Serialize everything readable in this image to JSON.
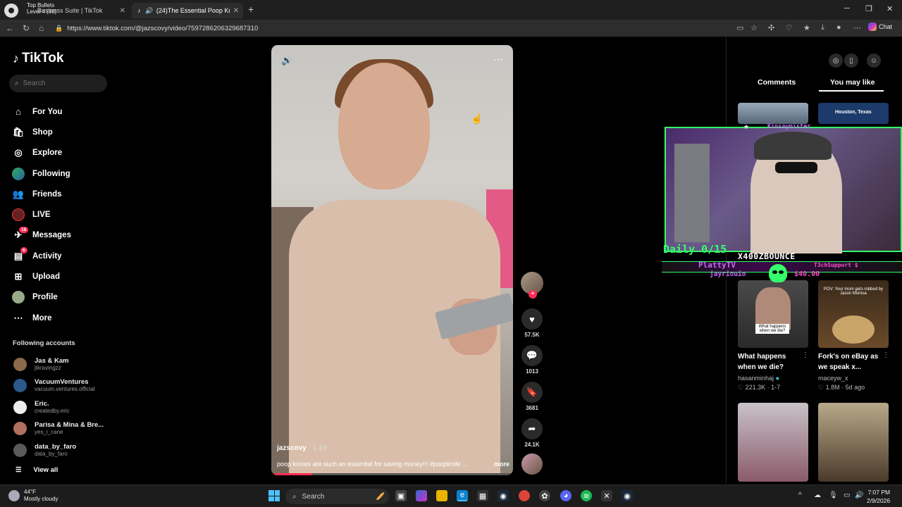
{
  "browser": {
    "obs_label_line1": "Top Bullets",
    "obs_label_line2": "Level 4  (86)",
    "tabs": [
      {
        "label": "Business Suite | TikTok"
      },
      {
        "label": "(24)The Essential Poop Knife"
      }
    ],
    "url": "https://www.tiktok.com/@jazscovy/video/7597286206329687310",
    "chat_label": "Chat"
  },
  "sidebar": {
    "logo": "TikTok",
    "search_placeholder": "Search",
    "items": [
      {
        "label": "For You",
        "icon": "home-icon"
      },
      {
        "label": "Shop",
        "icon": "shop-icon"
      },
      {
        "label": "Explore",
        "icon": "compass-icon"
      },
      {
        "label": "Following",
        "icon": "following-avatar-icon"
      },
      {
        "label": "Friends",
        "icon": "friends-icon"
      },
      {
        "label": "LIVE",
        "icon": "live-icon"
      },
      {
        "label": "Messages",
        "icon": "messages-icon",
        "badge": "18"
      },
      {
        "label": "Activity",
        "icon": "activity-icon",
        "badge": "6"
      },
      {
        "label": "Upload",
        "icon": "upload-icon"
      },
      {
        "label": "Profile",
        "icon": "profile-avatar-icon"
      },
      {
        "label": "More",
        "icon": "more-icon"
      }
    ],
    "following_title": "Following accounts",
    "accounts": [
      {
        "name": "Jas & Kam",
        "handle": "jtkravingzz",
        "color": "#8a6a4a"
      },
      {
        "name": "VacuumVentures",
        "handle": "vacuum.ventures.official",
        "color": "#2a5a8a"
      },
      {
        "name": "Eric.",
        "handle": "createdby.eric",
        "color": "#eeeeee"
      },
      {
        "name": "Parisa & Mina & Bre...",
        "handle": "yes_i_cane",
        "color": "#b07060"
      },
      {
        "name": "data_by_faro",
        "handle": "data_by_faro",
        "color": "#5a5a5a"
      }
    ],
    "view_all": "View all"
  },
  "video": {
    "author": "jazscovy",
    "date": "1-19",
    "caption": "poop knives are such an essential for saving money!!! #poopknife ...",
    "more": "more",
    "progress": 0.17
  },
  "actions": {
    "likes": "57.5K",
    "comments": "1013",
    "saves": "3681",
    "shares": "24.1K"
  },
  "right_panel": {
    "tabs": [
      "Comments",
      "You may like"
    ],
    "active_tab": "You may like",
    "thumb_texts": [
      "Houston, Texas",
      "What happens when we die?",
      "POV: Your mom gets robbed by Jason Momoa"
    ],
    "cards": [
      {
        "title": "What happens when we die?",
        "user": "hasanminhaj",
        "verified": true,
        "likes": "221.3K",
        "age": "1-7"
      },
      {
        "title": "Fork's on eBay as we speak x...",
        "user": "maceyw_x",
        "verified": false,
        "likes": "1.8M",
        "age": "5d ago"
      }
    ]
  },
  "stream_overlay": {
    "top_name": "Kinsaymister",
    "daily": "Daily 0/15",
    "handle": "X400ZBOUNCE",
    "platform": "PlattyTV",
    "tech": "T3chSupport $",
    "donor": "jayriouio",
    "amount": "$40.00"
  },
  "taskbar": {
    "temp": "44°F",
    "condition": "Mostly cloudy",
    "search_placeholder": "Search",
    "time": "7:07 PM",
    "date": "2/9/2026"
  }
}
